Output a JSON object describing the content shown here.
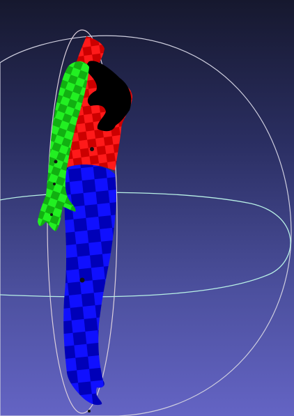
{
  "viewer": {
    "mode": "3D mesh viewer",
    "background": {
      "top": "#16182e",
      "bottom": "#6464c4"
    },
    "trackball": {
      "equator_color": "#b8f0e6",
      "meridian_color": "#cfcfdf",
      "vertical_color": "#dcd0dc",
      "show": true
    },
    "mesh": {
      "segment_colors": {
        "head_torso": "#ff1a1a",
        "arm": "#22f022",
        "legs": "#1010ff",
        "hair": "#000000",
        "checker_dark_red": "#cc0000",
        "checker_dark_green": "#11b011",
        "checker_dark_blue": "#0000b8"
      },
      "texture": "checkerboard",
      "segments": [
        "head-torso",
        "arm",
        "legs",
        "hair"
      ]
    }
  }
}
